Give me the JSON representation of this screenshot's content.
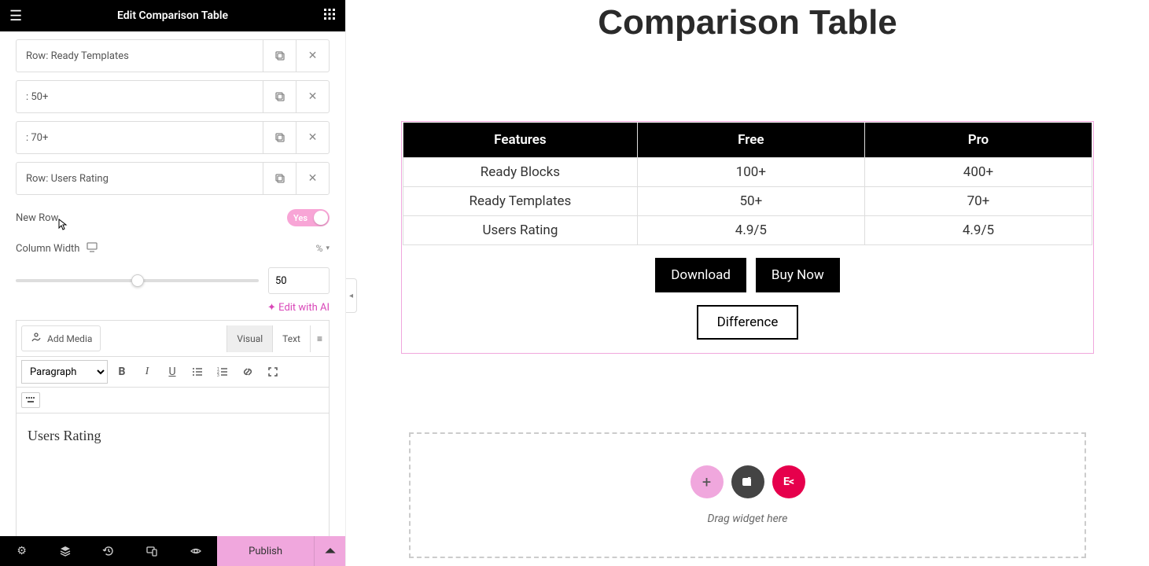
{
  "topbar": {
    "title": "Edit Comparison Table"
  },
  "rows": [
    {
      "label": "Row: Ready Templates"
    },
    {
      "label": ": 50+"
    },
    {
      "label": ": 70+"
    },
    {
      "label": "Row: Users Rating"
    }
  ],
  "fields": {
    "new_row": {
      "label": "New Row",
      "toggle": "Yes"
    },
    "col_width": {
      "label": "Column Width",
      "unit": "%",
      "value": "50"
    },
    "edit_ai": "Edit with AI"
  },
  "editor": {
    "add_media": "Add Media",
    "visual": "Visual",
    "text": "Text",
    "format": "Paragraph",
    "content": "Users Rating"
  },
  "bottombar": {
    "publish": "Publish"
  },
  "preview": {
    "title": "Comparison Table",
    "headers": [
      "Features",
      "Free",
      "Pro"
    ],
    "rows": [
      [
        "Ready Blocks",
        "100+",
        "400+"
      ],
      [
        "Ready Templates",
        "50+",
        "70+"
      ],
      [
        "Users Rating",
        "4.9/5",
        "4.9/5"
      ]
    ],
    "buttons": {
      "download": "Download",
      "buy": "Buy Now",
      "diff": "Difference"
    },
    "drop": "Drag widget here"
  }
}
